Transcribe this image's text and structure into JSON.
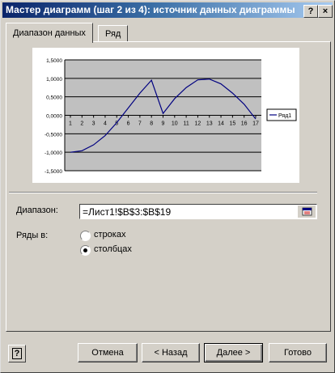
{
  "window": {
    "title": "Мастер диаграмм (шаг 2 из 4): источник данных диаграммы"
  },
  "titlebar": {
    "help_glyph": "?",
    "close_glyph": "×"
  },
  "tabs": [
    {
      "label": "Диапазон данных",
      "active": true
    },
    {
      "label": "Ряд",
      "active": false
    }
  ],
  "chart_data": {
    "type": "line",
    "categories": [
      "1",
      "2",
      "3",
      "4",
      "5",
      "6",
      "7",
      "8",
      "9",
      "10",
      "11",
      "12",
      "13",
      "14",
      "15",
      "16",
      "17"
    ],
    "series": [
      {
        "name": "Ряд1",
        "values": [
          -1.0,
          -0.96,
          -0.8,
          -0.55,
          -0.2,
          0.2,
          0.6,
          0.95,
          0.05,
          0.45,
          0.75,
          0.96,
          0.98,
          0.85,
          0.6,
          0.3,
          -0.1
        ]
      }
    ],
    "ylim": [
      -1.5,
      1.5
    ],
    "yticks": [
      "1,5000",
      "1,0000",
      "0,5000",
      "0,0000",
      "-0,5000",
      "-1,0000",
      "-1,5000"
    ],
    "grid": true,
    "legend": "right",
    "colors": {
      "plot_bg": "#c0c0c0",
      "line": "#000080"
    }
  },
  "range": {
    "label": "Диапазон:",
    "value": "=Лист1!$B$3:$B$19"
  },
  "series_in": {
    "label": "Ряды в:",
    "options": [
      {
        "label": "строках",
        "selected": false
      },
      {
        "label": "столбцах",
        "selected": true
      }
    ]
  },
  "buttons": {
    "cancel": "Отмена",
    "back": "< Назад",
    "next": "Далее >",
    "finish": "Готово"
  },
  "help_button": "?"
}
